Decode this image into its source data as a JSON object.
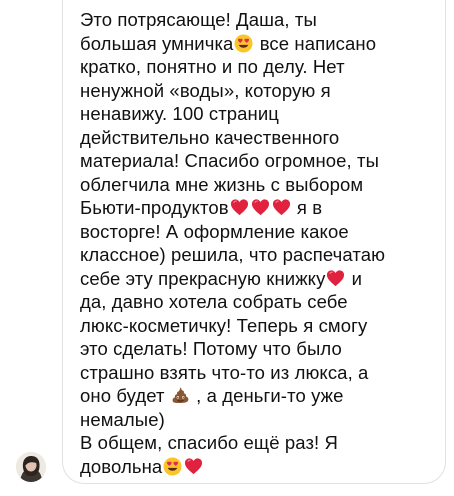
{
  "message": {
    "lines": [
      [
        {
          "t": "Это потрясающе! Даша, ты"
        }
      ],
      [
        {
          "t": "большая умничка"
        },
        {
          "icon": "heart-eyes"
        },
        {
          "t": " все написано"
        }
      ],
      [
        {
          "t": "кратко, понятно и по делу. Нет"
        }
      ],
      [
        {
          "t": "ненужной «воды», которую я"
        }
      ],
      [
        {
          "t": "ненавижу. 100 страниц"
        }
      ],
      [
        {
          "t": "действительно качественного"
        }
      ],
      [
        {
          "t": "материала! Спасибо огромное, ты"
        }
      ],
      [
        {
          "t": "облегчила мне жизнь с выбором"
        }
      ],
      [
        {
          "t": "Бьюти-продуктов"
        },
        {
          "icon": "red-heart"
        },
        {
          "icon": "red-heart"
        },
        {
          "icon": "red-heart"
        },
        {
          "t": " я в"
        }
      ],
      [
        {
          "t": "восторге! А оформление какое"
        }
      ],
      [
        {
          "t": "классное) решила, что распечатаю"
        }
      ],
      [
        {
          "t": "себе эту прекрасную книжку"
        },
        {
          "icon": "red-heart"
        },
        {
          "t": " и"
        }
      ],
      [
        {
          "t": "да, давно хотела собрать себе"
        }
      ],
      [
        {
          "t": "люкс-косметичку! Теперь я смогу"
        }
      ],
      [
        {
          "t": "это сделать! Потому что было"
        }
      ],
      [
        {
          "t": "страшно взять что-то из люкса, а"
        }
      ],
      [
        {
          "t": "оно будет "
        },
        {
          "icon": "poop"
        },
        {
          "t": " , а деньги-то уже"
        }
      ],
      [
        {
          "t": "немалые)"
        }
      ],
      [
        {
          "t": "В общем, спасибо ещё раз! Я"
        }
      ],
      [
        {
          "t": "довольна"
        },
        {
          "icon": "heart-eyes"
        },
        {
          "icon": "red-heart"
        }
      ]
    ]
  },
  "avatar": {
    "icon": "user-avatar"
  }
}
